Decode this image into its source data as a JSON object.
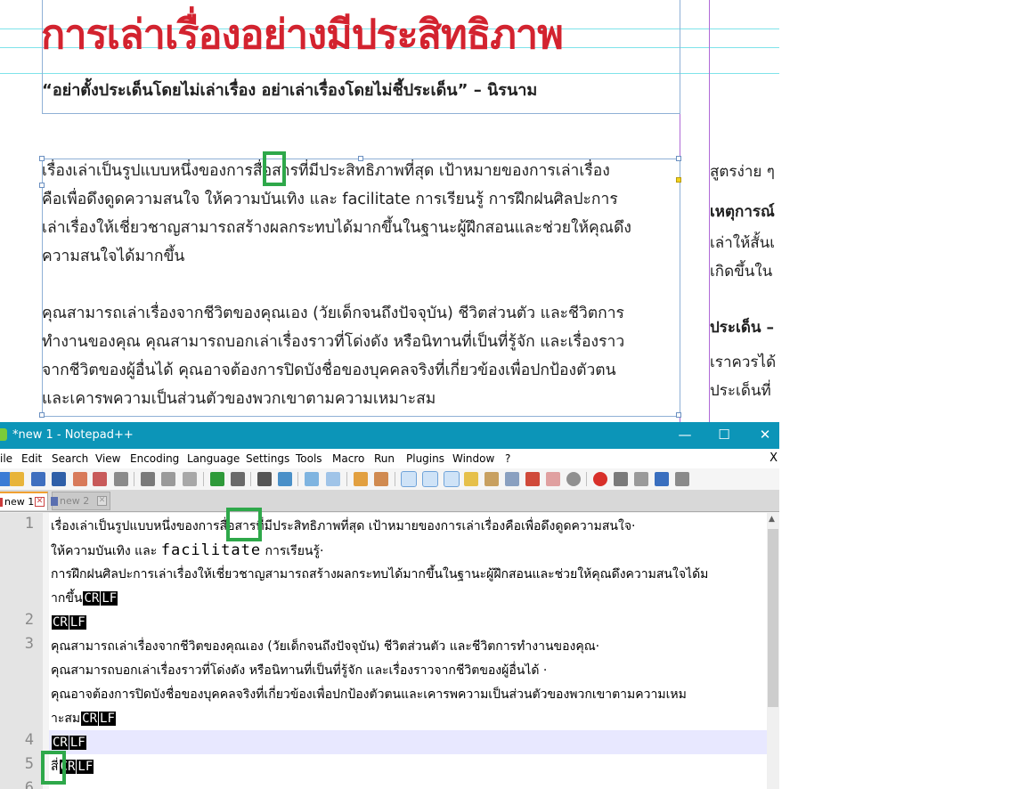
{
  "document": {
    "title": "การเล่าเรื่องอย่างมีประสิทธิภาพ",
    "quote": "“อย่าตั้งประเด็นโดยไม่เล่าเรื่อง อย่าเล่าเรื่องโดยไม่ชี้ประเด็น” – นิรนาม",
    "paragraph1": [
      "เรื่องเล่าเป็นรูปแบบหนึ่งของการสื่อสารที่มีประสิทธิภาพที่สุด เป้าหมายของการเล่าเรื่อง",
      "คือเพื่อดึงดูดความสนใจ ให้ความบันเทิง และ facilitate การเรียนรู้ การฝึกฝนศิลปะการ",
      "เล่าเรื่องให้เชี่ยวชาญสามารถสร้างผลกระทบได้มากขึ้นในฐานะผู้ฝึกสอนและช่วยให้คุณดึง",
      "ความสนใจได้มากขึ้น"
    ],
    "paragraph2": [
      "คุณสามารถเล่าเรื่องจากชีวิตของคุณเอง (วัยเด็กจนถึงปัจจุบัน) ชีวิตส่วนตัว และชีวิตการ",
      "ทำงานของคุณ คุณสามารถบอกเล่าเรื่องราวที่โด่งดัง หรือนิทานที่เป็นที่รู้จัก และเรื่องราว",
      "จากชีวิตของผู้อื่นได้ คุณอาจต้องการปิดบังชื่อของบุคคลจริงที่เกี่ยวข้องเพื่อปกป้องตัวตน",
      "และเคารพความเป็นส่วนตัวของพวกเขาตามความเหมาะสม"
    ],
    "side_column": [
      {
        "text": "สูตรง่าย ๆ",
        "bold": false
      },
      {
        "text": "เหตุการณ์",
        "bold": true
      },
      {
        "text": "เล่าให้สั้นเ",
        "bold": false
      },
      {
        "text": "เกิดขึ้นใน",
        "bold": false
      },
      {
        "text": "ประเด็น –",
        "bold": true
      },
      {
        "text": "เราควรได้",
        "bold": false
      },
      {
        "text": "ประเด็นที่",
        "bold": false
      }
    ]
  },
  "notepad": {
    "window_title": "*new 1 - Notepad++",
    "window_buttons": {
      "minimize": "—",
      "maximize": "☐",
      "close": "✕"
    },
    "menu": [
      "ile",
      "Edit",
      "Search",
      "View",
      "Encoding",
      "Language",
      "Settings",
      "Tools",
      "Macro",
      "Run",
      "Plugins",
      "Window",
      "?"
    ],
    "menu_close": "X",
    "tabs": [
      {
        "label": "new 1",
        "close": "✕"
      },
      {
        "label": "new 2",
        "close": "✕"
      }
    ],
    "line_numbers": [
      "1",
      "2",
      "3",
      "4",
      "5",
      "6"
    ],
    "eol_cr": "CR",
    "eol_lf": "LF",
    "lines": {
      "l1a": "เรื่องเล่าเป็นรูปแบบหนึ่งของการสื่อสารที่มีประสิทธิภาพที่สุด เป้าหมายของการเล่าเรื่องคือเพื่อดึงดูดความสนใจ·",
      "l1b_pre": "ให้ความบันเทิง และ ",
      "l1b_mono": "facilitate",
      "l1b_post": " การเรียนรู้·",
      "l1c": "การฝึกฝนศิลปะการเล่าเรื่องให้เชี่ยวชาญสามารถสร้างผลกระทบได้มากขึ้นในฐานะผู้ฝึกสอนและช่วยให้คุณดึงความสนใจได้ม",
      "l1d": "ากขึ้น",
      "l3a": "คุณสามารถเล่าเรื่องจากชีวิตของคุณเอง (วัยเด็กจนถึงปัจจุบัน) ชีวิตส่วนตัว และชีวิตการทำงานของคุณ·",
      "l3b": "คุณสามารถบอกเล่าเรื่องราวที่โด่งดัง หรือนิทานที่เป็นที่รู้จัก และเรื่องราวจากชีวิตของผู้อื่นได้ ·",
      "l3c": "คุณอาจต้องการปิดบังชื่อของบุคคลจริงที่เกี่ยวข้องเพื่อปกป้องตัวตนและเคารพความเป็นส่วนตัวของพวกเขาตามความเหม",
      "l3d": "าะสม",
      "l5": "สี่"
    }
  },
  "colors": {
    "title_red": "#d3232f",
    "titlebar_blue": "#0c95b8",
    "highlight_green": "#2ea84a",
    "current_line": "#e8e8ff"
  }
}
